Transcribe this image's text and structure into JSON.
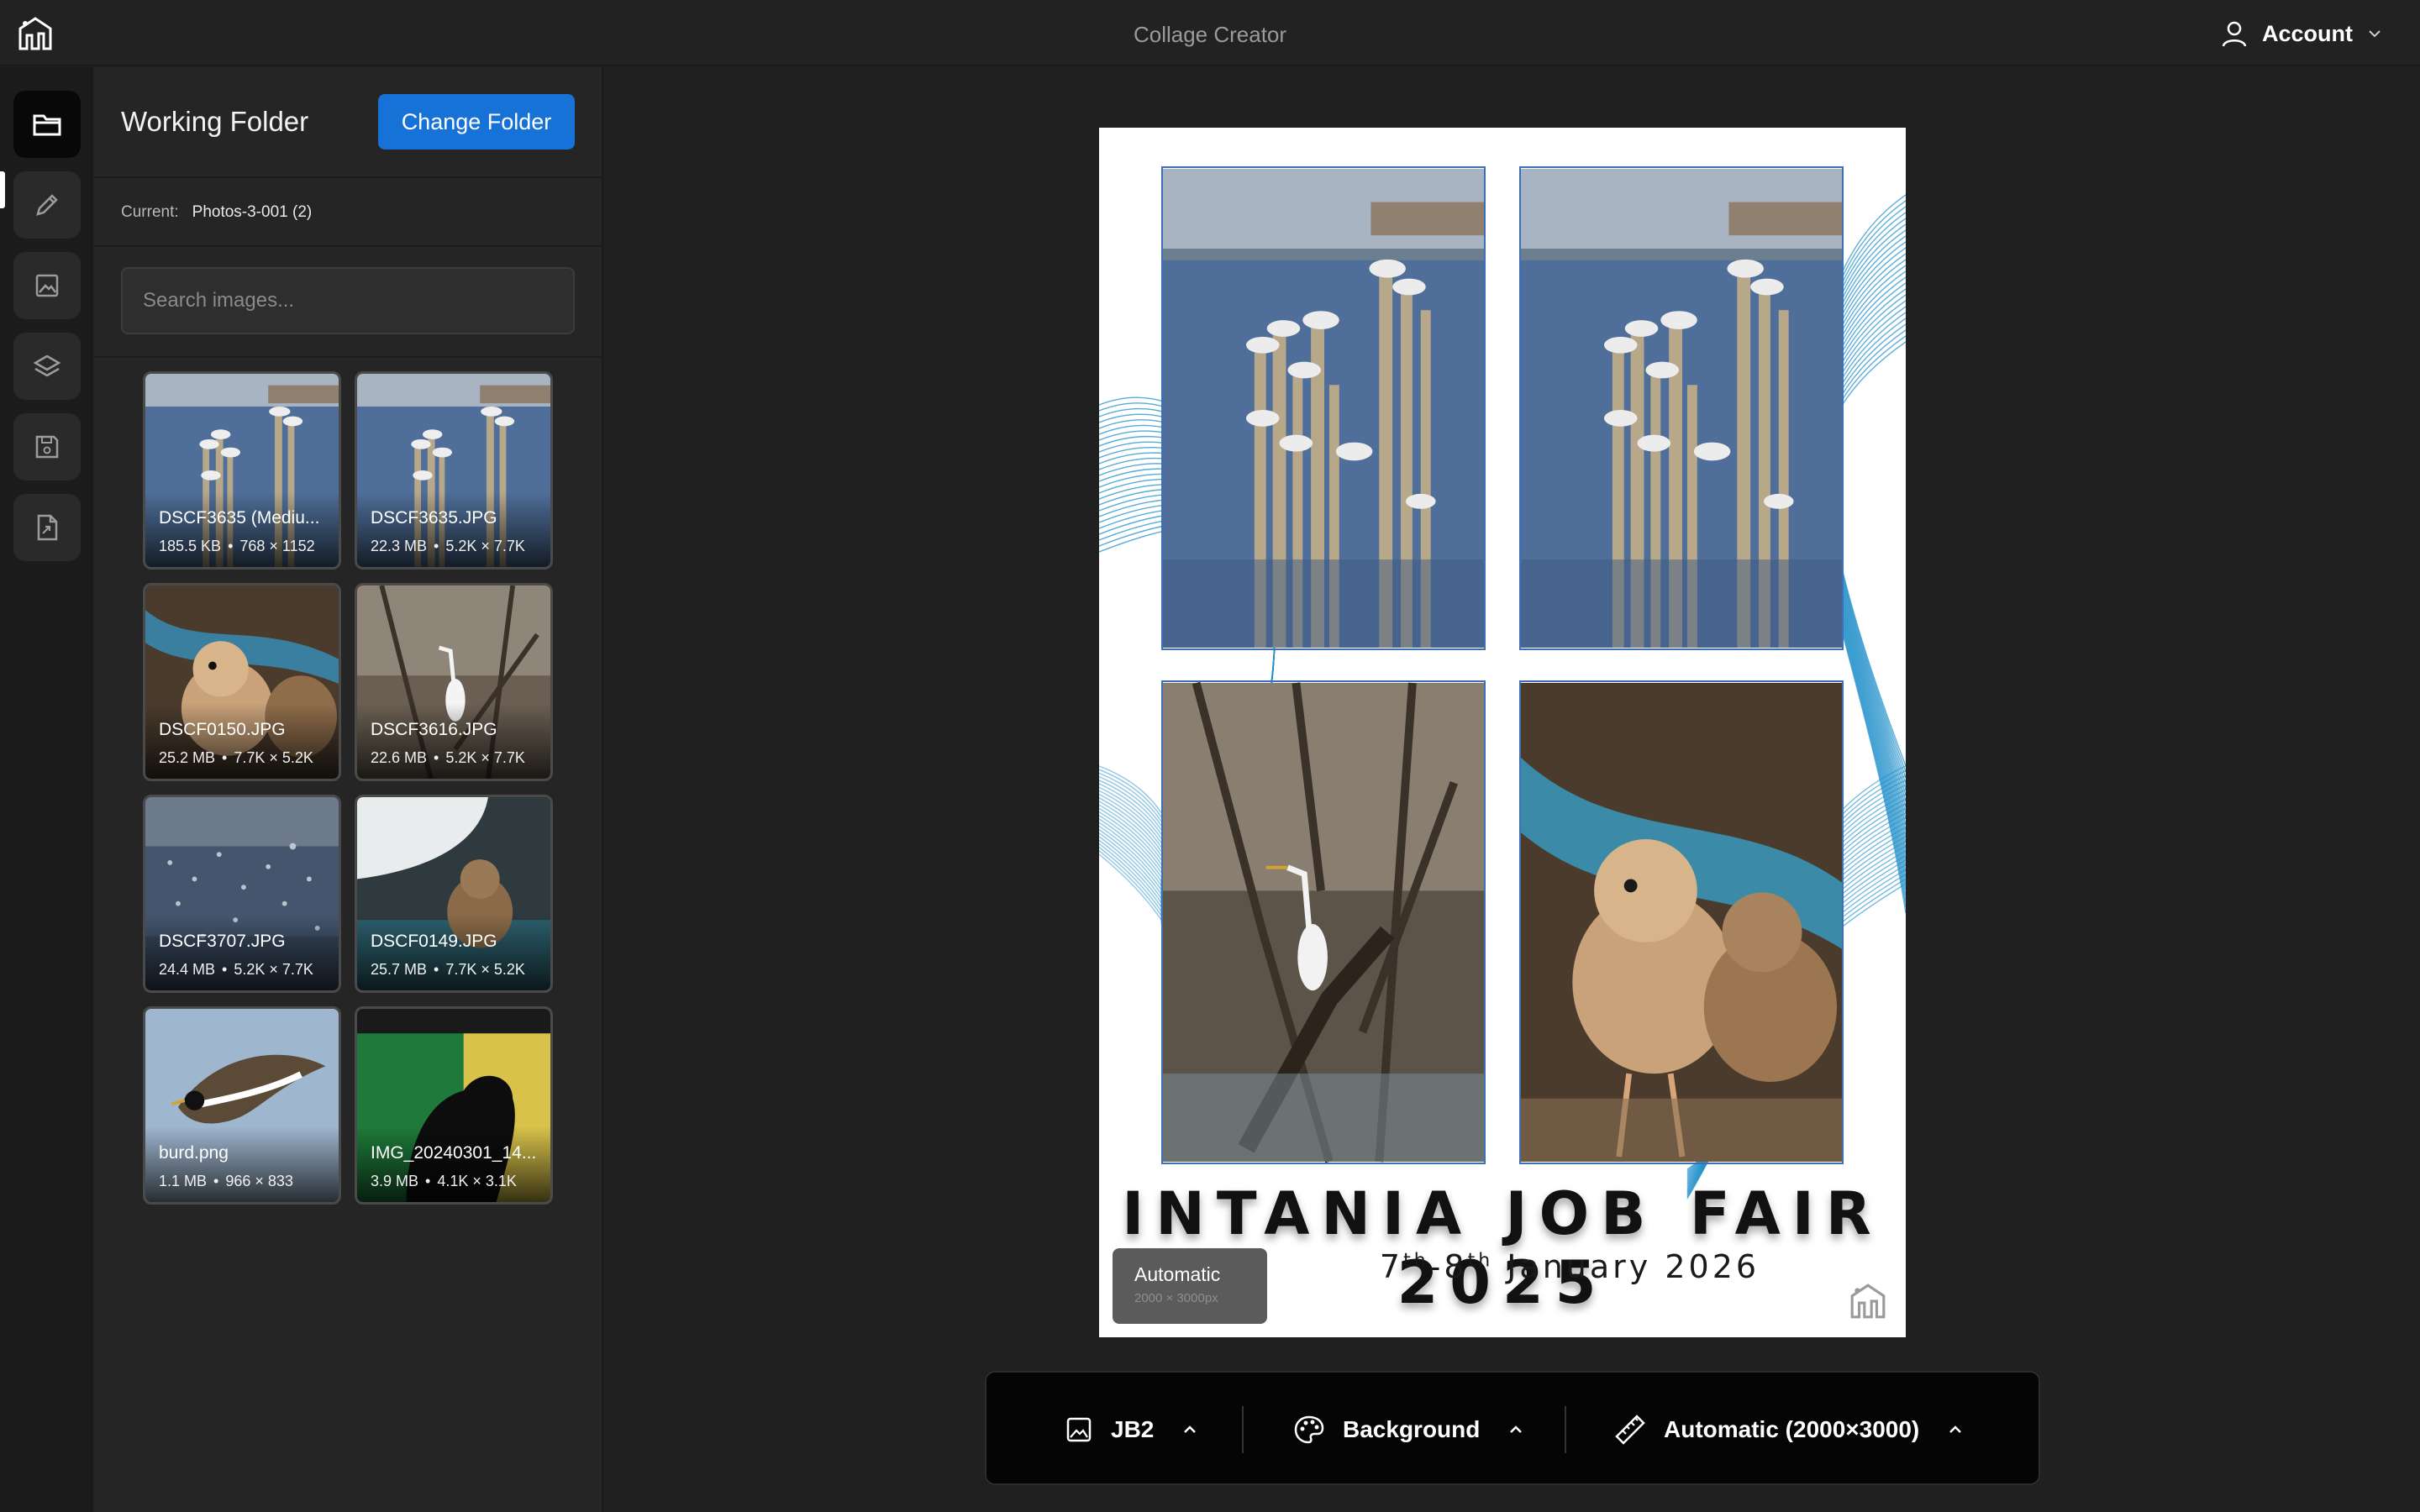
{
  "app": {
    "title": "Collage Creator",
    "account_label": "Account"
  },
  "rail": {
    "items": [
      "folder",
      "edit",
      "image",
      "layers",
      "save",
      "export"
    ],
    "active": "folder"
  },
  "panel": {
    "title": "Working Folder",
    "change_button": "Change Folder",
    "current_label": "Current:",
    "current_value": "Photos-3-001 (2)",
    "search_placeholder": "Search images...",
    "images": [
      {
        "name": "DSCF3635 (Mediu...",
        "size": "185.5 KB",
        "dims": "768 × 1152",
        "scene": "gulls"
      },
      {
        "name": "DSCF3635.JPG",
        "size": "22.3 MB",
        "dims": "5.2K × 7.7K",
        "scene": "gulls"
      },
      {
        "name": "DSCF0150.JPG",
        "size": "25.2 MB",
        "dims": "7.7K × 5.2K",
        "scene": "chicks"
      },
      {
        "name": "DSCF3616.JPG",
        "size": "22.6 MB",
        "dims": "5.2K × 7.7K",
        "scene": "egret"
      },
      {
        "name": "DSCF3707.JPG",
        "size": "24.4 MB",
        "dims": "5.2K × 7.7K",
        "scene": "water"
      },
      {
        "name": "DSCF0149.JPG",
        "size": "25.7 MB",
        "dims": "7.7K × 5.2K",
        "scene": "chick-bowl"
      },
      {
        "name": "burd.png",
        "size": "1.1 MB",
        "dims": "966 × 833",
        "scene": "lapwing"
      },
      {
        "name": "IMG_20240301_14...",
        "size": "3.9 MB",
        "dims": "4.1K × 3.1K",
        "scene": "crow"
      }
    ]
  },
  "poster": {
    "title": "INTANIA JOB FAIR 2025",
    "date_d1": "7",
    "date_sup1": "th",
    "date_mid": "-8",
    "date_sup2": "th",
    "date_rest": " January 2026",
    "badge_label": "Automatic",
    "badge_size": "2000 × 3000px"
  },
  "toolbar": {
    "template_label": "JB2",
    "background_label": "Background",
    "size_label": "Automatic (2000×3000)"
  },
  "colors": {
    "accent": "#1672d6",
    "frame": "#3c6fb4",
    "deco_lines": "#1f8fc9"
  }
}
